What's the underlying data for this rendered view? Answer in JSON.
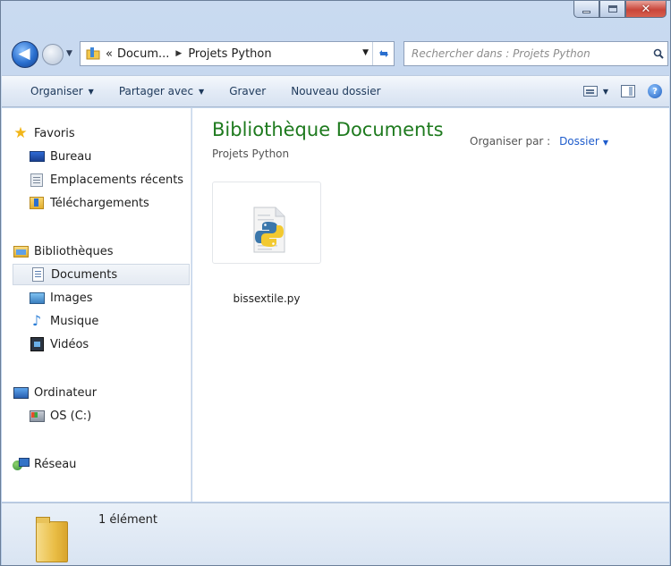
{
  "window": {
    "controls": [
      "minimize",
      "maximize",
      "close"
    ]
  },
  "navbar": {
    "breadcrumb_prefix": "«",
    "breadcrumb": [
      "Docum...",
      "Projets Python"
    ],
    "search_placeholder": "Rechercher dans : Projets Python"
  },
  "toolbar": {
    "organize": "Organiser",
    "share": "Partager avec",
    "burn": "Graver",
    "new_folder": "Nouveau dossier"
  },
  "sidebar": {
    "favorites": {
      "label": "Favoris",
      "items": [
        {
          "label": "Bureau",
          "icon": "desktop-icon"
        },
        {
          "label": "Emplacements récents",
          "icon": "recent-places-icon"
        },
        {
          "label": "Téléchargements",
          "icon": "downloads-icon"
        }
      ]
    },
    "libraries": {
      "label": "Bibliothèques",
      "items": [
        {
          "label": "Documents",
          "icon": "documents-icon",
          "selected": true
        },
        {
          "label": "Images",
          "icon": "images-icon"
        },
        {
          "label": "Musique",
          "icon": "music-icon"
        },
        {
          "label": "Vidéos",
          "icon": "videos-icon"
        }
      ]
    },
    "computer": {
      "label": "Ordinateur",
      "items": [
        {
          "label": "OS (C:)",
          "icon": "drive-icon"
        }
      ]
    },
    "network": {
      "label": "Réseau"
    }
  },
  "main": {
    "library_title": "Bibliothèque Documents",
    "library_subtitle": "Projets Python",
    "arrange_label": "Organiser par :",
    "arrange_value": "Dossier",
    "files": [
      {
        "name": "bissextile.py",
        "icon": "python-file-icon"
      }
    ]
  },
  "details": {
    "count": "1 élément"
  },
  "colors": {
    "library_title": "#1e7a1e",
    "link": "#1e5ccc",
    "command_text": "#1e395b"
  }
}
